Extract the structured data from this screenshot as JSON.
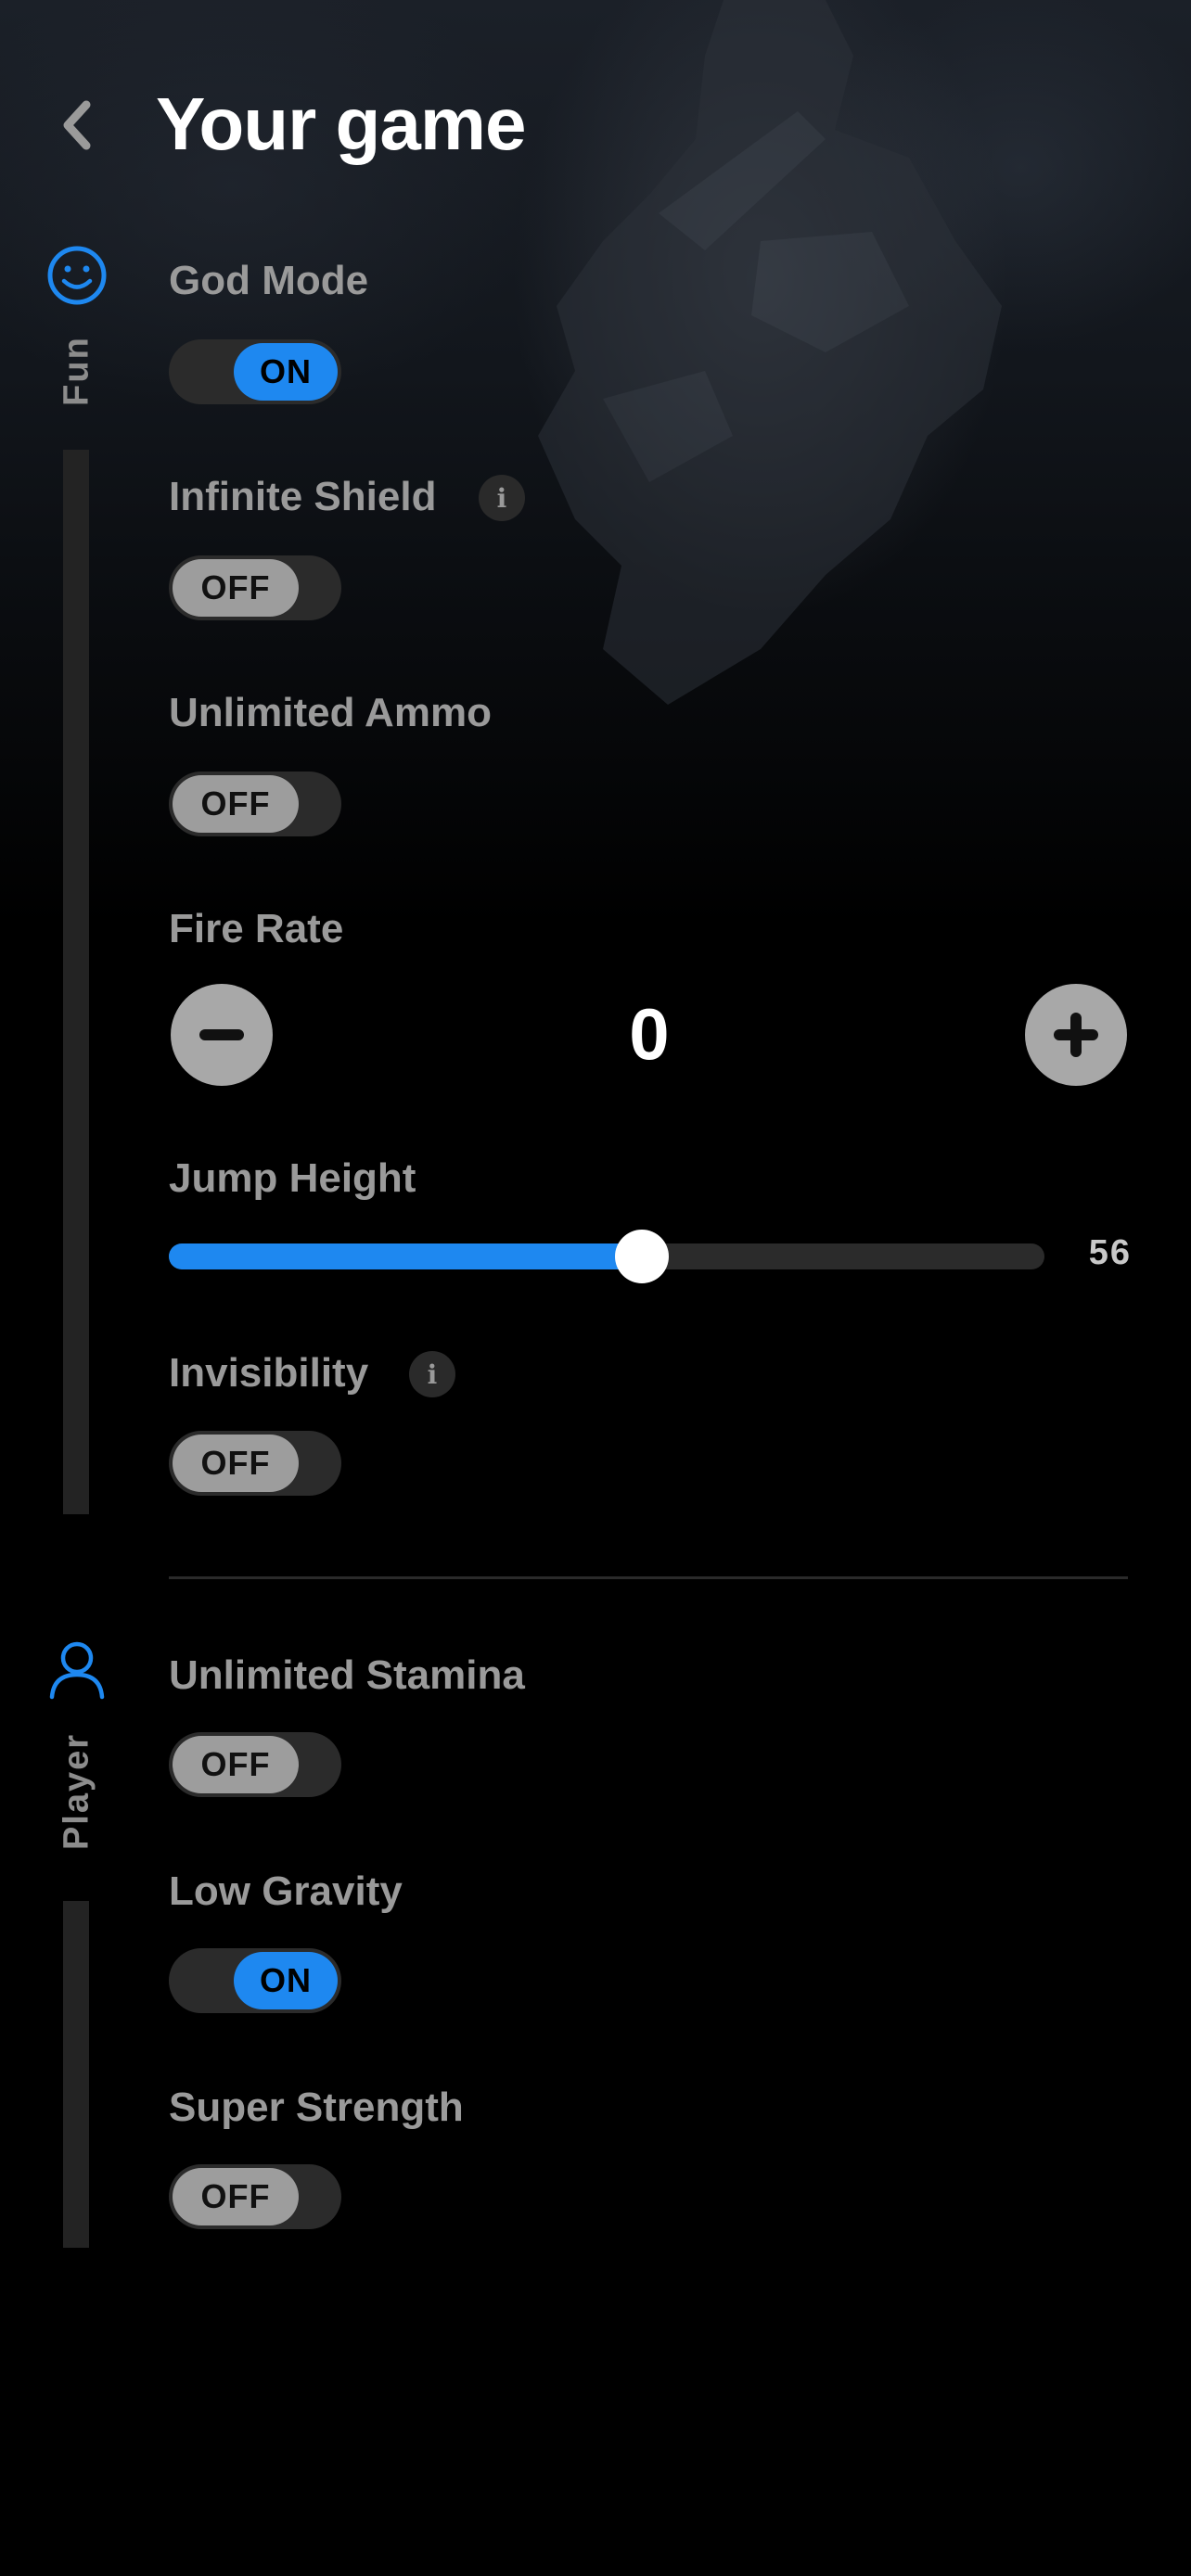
{
  "header": {
    "title": "Your game",
    "back_icon": "chevron-left-icon"
  },
  "colors": {
    "accent": "#1e88f0",
    "background": "#000000"
  },
  "categories": [
    {
      "label": "Fun",
      "icon": "smiley-icon",
      "settings": [
        {
          "label": "God Mode",
          "type": "toggle",
          "state": "ON"
        },
        {
          "label": "Infinite Shield",
          "type": "toggle",
          "state": "OFF",
          "info_icon": "i"
        },
        {
          "label": "Unlimited Ammo",
          "type": "toggle",
          "state": "OFF"
        },
        {
          "label": "Fire Rate",
          "type": "stepper",
          "value": "0"
        },
        {
          "label": "Jump Height",
          "type": "slider",
          "value": "56",
          "fraction": 0.54
        },
        {
          "label": "Invisibility",
          "type": "toggle",
          "state": "OFF",
          "info_icon": "i"
        }
      ]
    },
    {
      "label": "Player",
      "icon": "user-icon",
      "settings": [
        {
          "label": "Unlimited Stamina",
          "type": "toggle",
          "state": "OFF"
        },
        {
          "label": "Low Gravity",
          "type": "toggle",
          "state": "ON"
        },
        {
          "label": "Super Strength",
          "type": "toggle",
          "state": "OFF"
        }
      ]
    }
  ]
}
